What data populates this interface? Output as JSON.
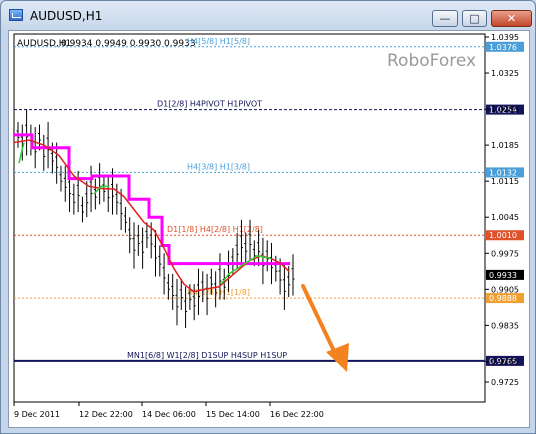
{
  "window": {
    "title": "AUDUSD,H1",
    "minimize_icon": "minimize-icon",
    "maximize_icon": "maximize-icon",
    "close_icon": "close-icon"
  },
  "chart_header": {
    "symbol": "AUDUSD,H1",
    "ohlc": "0.9934 0.9949 0.9930 0.9933"
  },
  "watermark": "RoboForex",
  "price_axis": {
    "ticks": [
      "1.0395",
      "1.0325",
      "1.0255",
      "1.0185",
      "1.0115",
      "1.0045",
      "0.9975",
      "0.9905",
      "0.9835",
      "0.9765",
      "0.9725"
    ]
  },
  "time_axis": {
    "ticks": [
      "9 Dec 2011",
      "12 Dec 22:00",
      "14 Dec 06:00",
      "15 Dec 14:00",
      "16 Dec 22:00"
    ]
  },
  "levels": [
    {
      "label": "H4[5/8] H1[5/8]",
      "price": "1.0376",
      "color": "#4a9fd8",
      "style": "dotted"
    },
    {
      "label": "D1[2/8] H4PIVOT H1PIVOT",
      "price": "1.0254",
      "color": "#14145a",
      "style": "dashed"
    },
    {
      "label": "H4[3/8] H1[3/8]",
      "price": "1.0132",
      "color": "#4a9fd8",
      "style": "dotted"
    },
    {
      "label": "D1[1/8] H4[2/8] H1[2/8]",
      "price": "1.0010",
      "color": "#e0502a",
      "style": "dotted"
    },
    {
      "label": "H4[1/8] H1[1/8]",
      "price": "0.9888",
      "color": "#f0a030",
      "style": "dotted"
    },
    {
      "label": "MN1[6/8] W1[2/8] D1SUP H4SUP H1SUP",
      "price": "0.9766",
      "color": "#14145a",
      "style": "solid"
    }
  ],
  "current_price": "0.9933",
  "colors": {
    "magenta_line": "#ff00ff",
    "red_line": "#e02020",
    "green_line": "#33cc33",
    "arrow": "#f58220",
    "candles": "#000000"
  }
}
